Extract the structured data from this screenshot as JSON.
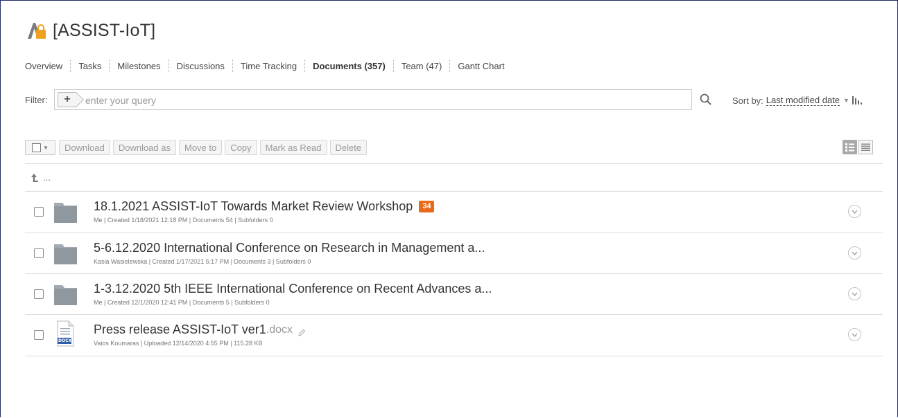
{
  "header": {
    "project_title": "[ASSIST-IoT]"
  },
  "nav": {
    "items": [
      {
        "label": "Overview"
      },
      {
        "label": "Tasks"
      },
      {
        "label": "Milestones"
      },
      {
        "label": "Discussions"
      },
      {
        "label": "Time Tracking"
      },
      {
        "label": "Documents (357)",
        "active": true
      },
      {
        "label": "Team (47)"
      },
      {
        "label": "Gantt Chart"
      }
    ]
  },
  "filter": {
    "label": "Filter:",
    "add_label": "+",
    "placeholder": "enter your query",
    "value": ""
  },
  "sort": {
    "label": "Sort by:",
    "value": "Last modified date"
  },
  "toolbar": {
    "buttons": [
      "Download",
      "Download as",
      "Move to",
      "Copy",
      "Mark as Read",
      "Delete"
    ]
  },
  "up_folder": {
    "label": "..."
  },
  "files": [
    {
      "type": "folder",
      "title": "18.1.2021 ASSIST-IoT Towards Market Review Workshop",
      "badge": "34",
      "meta": "Me | Created 1/18/2021 12:18 PM | Documents 54 | Subfolders 0"
    },
    {
      "type": "folder",
      "title": "5-6.12.2020 International Conference on Research in Management a...",
      "meta": "Kasia Wasielewska | Created 1/17/2021 5:17 PM | Documents 3 | Subfolders 0"
    },
    {
      "type": "folder",
      "title": "1-3.12.2020 5th IEEE International Conference on Recent Advances a...",
      "meta": "Me | Created 12/1/2020 12:41 PM | Documents 5 | Subfolders 0"
    },
    {
      "type": "file",
      "title": "Press release ASSIST-IoT ver1",
      "ext": ".docx",
      "icon_label": "DOCX",
      "meta": "Vaios Koumaras | Uploaded 12/14/2020 4:55 PM | 115.28 KB"
    }
  ],
  "colors": {
    "badge": "#e86a1a",
    "folder": "#a3aab2",
    "frame_border": "#1f2a6b"
  }
}
